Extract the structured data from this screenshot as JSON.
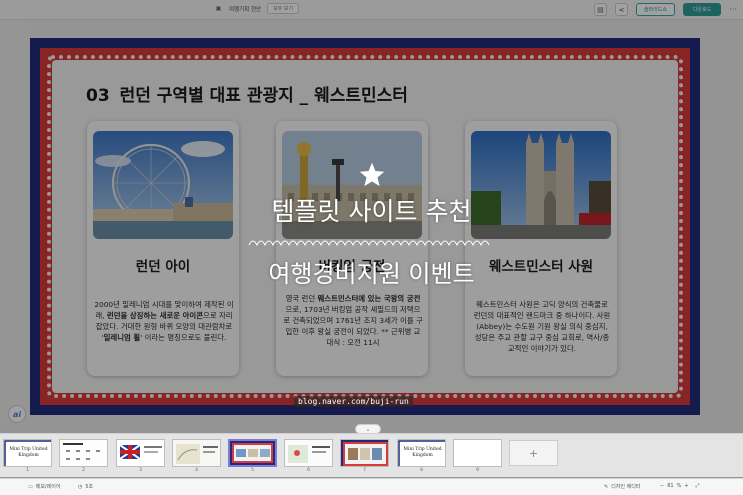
{
  "toolbar": {
    "doc_title": "여행기획 현안",
    "tag_label": "모두 보기",
    "share_label": "슬라이드쇼",
    "download_label": "다운로드",
    "accent_color": "#2d9e9a"
  },
  "slide": {
    "number_label": "03",
    "title": "런던 구역별 대표 관광지 _ 웨스트민스터",
    "cards": [
      {
        "title": "런던 아이",
        "desc_parts": [
          "2000년 밀레니엄 시대를 맞이하여 제작된 이래, ",
          "런던을 상징하는 새로운 아이콘",
          "으로 자리 잡았다. 거대한 원형 바퀴 모양의 대관람차로 '",
          "밀레니엄 휠",
          "' 이라는 명칭으로도 불린다."
        ]
      },
      {
        "title": "버킹엄 궁전",
        "desc_parts": [
          "영국 런던 ",
          "웨스트민스터에 있는 국왕의 궁전",
          "으로, 1703년 버킹엄 공작 셰필드의 저택으로 건축되었으며 1761년 조지 3세가 이를 구입한 이후 왕실 궁전이 되었다. ** 근위병 교대식 : 오전 11시"
        ]
      },
      {
        "title": "웨스트민스터 사원",
        "desc_parts": [
          "웨스트민스터 사원은 고딕 양식의 건축물로 런던의 대표적인 랜드마크 중 하나이다. 사원(Abbey)는 수도원 기원 왕실 의식 중심지, 성당은 주교 관할 교구 중심 교회로, 역사/종교적인 이야기가 있다."
        ]
      }
    ]
  },
  "watermark": {
    "line1": "템플릿 사이트 추천",
    "line2": "여행경비지원 이벤트",
    "url": "blog.naver.com/buji-run"
  },
  "filmstrip": {
    "thumb_title": "Mini Trip United Kingdom",
    "numbers": [
      "1",
      "2",
      "3",
      "4",
      "5",
      "6",
      "7",
      "8",
      "9"
    ],
    "add_label": "+",
    "selected": "5"
  },
  "bottombar": {
    "notes_label": "메모/레이어",
    "time_label": "5초",
    "design_label": "디자인 에디터",
    "zoom_value": "81",
    "zoom_unit": "%"
  },
  "ai_label": "ai"
}
